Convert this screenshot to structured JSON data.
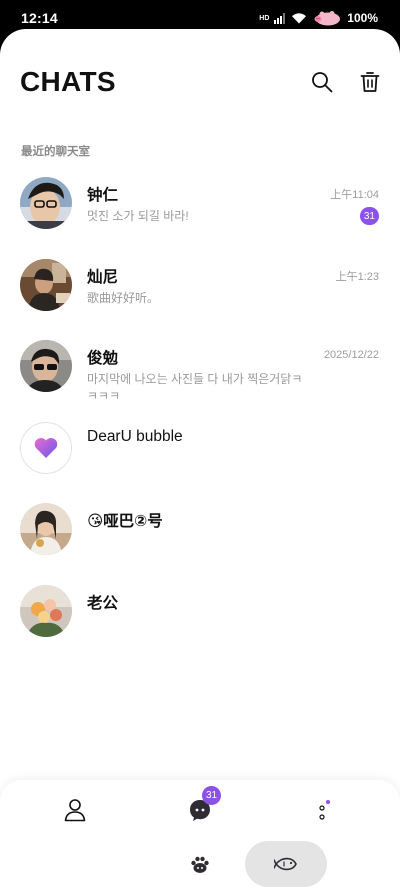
{
  "status_bar": {
    "time": "12:14",
    "network": "HD",
    "battery": "100%"
  },
  "header": {
    "title": "CHATS"
  },
  "section_label": "最近的聊天室",
  "chats": [
    {
      "name": "钟仁",
      "preview": "멋진 소가 되길 바라!",
      "time": "上午11:04",
      "unread": "31"
    },
    {
      "name": "灿尼",
      "preview": "歌曲好好听。",
      "time": "上午1:23"
    },
    {
      "name": "俊勉",
      "preview": "마지막에 나오는 사진들 다 내가 찍은거닭ㅋㅋㅋㅋ",
      "time": "2025/12/22"
    },
    {
      "name": "DearU bubble"
    },
    {
      "name": "😘哑巴②号"
    },
    {
      "name": "老公"
    }
  ],
  "bottom_nav": {
    "chats_badge": "31"
  },
  "colors": {
    "accent": "#8a52e8",
    "muted_text": "#9a9a9a"
  }
}
